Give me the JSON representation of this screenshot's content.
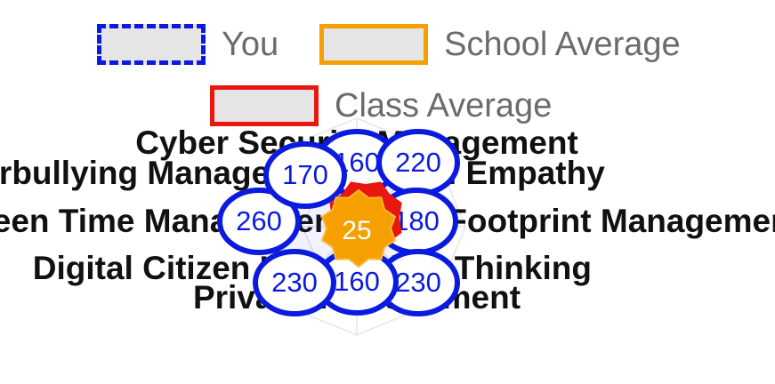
{
  "chart_data": {
    "type": "radar",
    "axes": [
      "Cyber Security Management",
      "Digital Empathy",
      "Digital Footprint Management",
      "Critical Thinking",
      "Privacy Management",
      "Digital Citizen Identity",
      "Screen Time Management",
      "Cyberbullying Management"
    ],
    "series": [
      {
        "name": "You",
        "values": [
          160,
          220,
          180,
          230,
          160,
          230,
          260,
          170
        ],
        "color": "#0a1adf",
        "style": "dashed"
      },
      {
        "name": "School Average",
        "values": [
          25,
          25,
          25,
          25,
          25,
          25,
          25,
          25
        ],
        "color": "#f5a000",
        "style": "solid"
      },
      {
        "name": "Class Average",
        "values": [
          25,
          25,
          25,
          25,
          25,
          25,
          25,
          25
        ],
        "color": "#e8170f",
        "style": "solid"
      }
    ],
    "value_labels": [
      {
        "axis": "Cyber Security Management",
        "text": "160"
      },
      {
        "axis": "Digital Empathy",
        "text": "220"
      },
      {
        "axis": "Digital Footprint Management",
        "text": "180"
      },
      {
        "axis": "Critical Thinking",
        "text": "230"
      },
      {
        "axis": "Privacy Management",
        "text": "160"
      },
      {
        "axis": "Digital Citizen Identity",
        "text": "230"
      },
      {
        "axis": "Screen Time Management",
        "text": "260"
      },
      {
        "axis": "Cyberbullying Management",
        "text": "170"
      }
    ],
    "center_label": "25",
    "legend_placement": "top-center"
  }
}
